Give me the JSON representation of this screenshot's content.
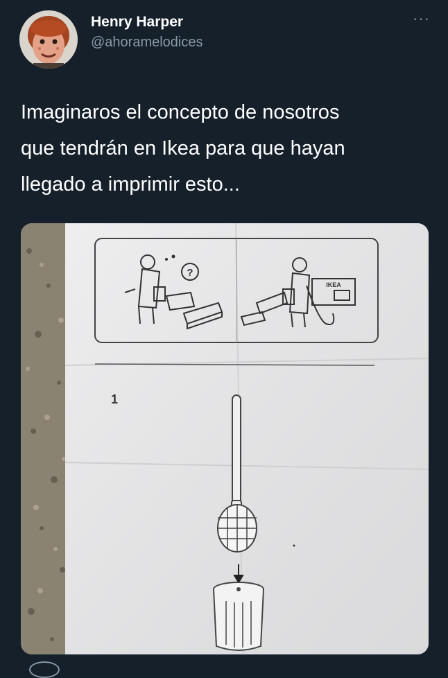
{
  "author": {
    "display_name": "Henry Harper",
    "handle": "@ahoramelodices"
  },
  "menu": {
    "more_label": "···"
  },
  "tweet": {
    "lines": [
      "Imaginaros el concepto de nosotros",
      "que tendrán en Ikea para que hayan",
      "llegado a imprimir esto..."
    ]
  },
  "media": {
    "box_label": "IKEA",
    "step_number": "1",
    "question_mark": "?"
  }
}
